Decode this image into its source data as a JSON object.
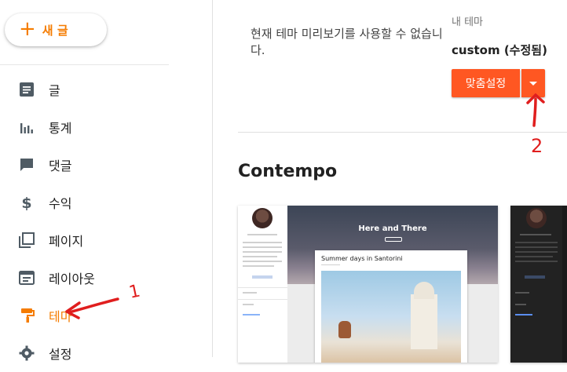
{
  "sidebar": {
    "new_post_label": "새 글",
    "items": [
      {
        "label": "글",
        "icon": "posts-icon"
      },
      {
        "label": "통계",
        "icon": "stats-icon"
      },
      {
        "label": "댓글",
        "icon": "comment-icon"
      },
      {
        "label": "수익",
        "icon": "dollar-icon"
      },
      {
        "label": "페이지",
        "icon": "pages-icon"
      },
      {
        "label": "레이아웃",
        "icon": "layout-icon"
      },
      {
        "label": "테마",
        "icon": "paint-roller-icon",
        "active": true
      },
      {
        "label": "설정",
        "icon": "gear-icon"
      }
    ]
  },
  "main": {
    "preview_message": "현재 테마 미리보기를 사용할 수 없습니다.",
    "my_theme_label": "내 테마",
    "theme_name": "custom (수정됨)",
    "customize_label": "맞춤설정",
    "section_title": "Contempo"
  },
  "thumbnail": {
    "hero_title": "Here and There",
    "post_title": "Summer days in Santorini"
  },
  "annotations": [
    "1",
    "2"
  ],
  "colors": {
    "accent": "#f57c00",
    "button": "#ff5722",
    "annotation": "#e01e1e"
  }
}
